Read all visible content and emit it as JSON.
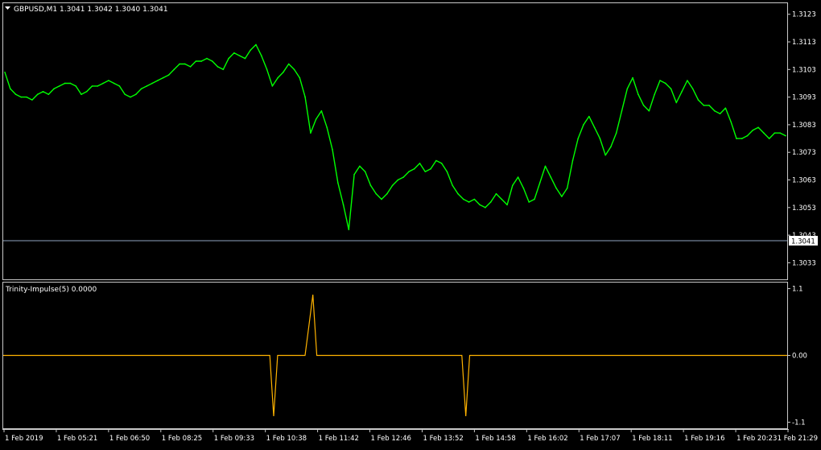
{
  "chart_data": [
    {
      "type": "line",
      "panel": "main",
      "symbol_timeframe": "GBPUSD,M1",
      "ohlc": {
        "open": "1.3041",
        "high": "1.3042",
        "low": "1.3040",
        "close": "1.3041"
      },
      "header_text": "GBPUSD,M1  1.3041 1.3042 1.3040 1.3041",
      "ylim": [
        1.3027,
        1.3127
      ],
      "y_ticks": [
        "1.3123",
        "1.3113",
        "1.3103",
        "1.3093",
        "1.3083",
        "1.3073",
        "1.3063",
        "1.3053",
        "1.3043",
        "1.3033"
      ],
      "current_price": "1.3041",
      "x_ticks": [
        "1 Feb 2019",
        "1 Feb 05:21",
        "1 Feb 06:50",
        "1 Feb 08:25",
        "1 Feb 09:33",
        "1 Feb 10:38",
        "1 Feb 11:42",
        "1 Feb 12:46",
        "1 Feb 13:52",
        "1 Feb 14:58",
        "1 Feb 16:02",
        "1 Feb 17:07",
        "1 Feb 18:11",
        "1 Feb 19:16",
        "1 Feb 20:23",
        "1 Feb 21:29"
      ],
      "series": [
        {
          "color": "#00ff00",
          "values": [
            1.3102,
            1.3096,
            1.3094,
            1.3093,
            1.3093,
            1.3092,
            1.3094,
            1.3095,
            1.3094,
            1.3096,
            1.3097,
            1.3098,
            1.3098,
            1.3097,
            1.3094,
            1.3095,
            1.3097,
            1.3097,
            1.3098,
            1.3099,
            1.3098,
            1.3097,
            1.3094,
            1.3093,
            1.3094,
            1.3096,
            1.3097,
            1.3098,
            1.3099,
            1.31,
            1.3101,
            1.3103,
            1.3105,
            1.3105,
            1.3104,
            1.3106,
            1.3106,
            1.3107,
            1.3106,
            1.3104,
            1.3103,
            1.3107,
            1.3109,
            1.3108,
            1.3107,
            1.311,
            1.3112,
            1.3108,
            1.3103,
            1.3097,
            1.31,
            1.3102,
            1.3105,
            1.3103,
            1.31,
            1.3093,
            1.308,
            1.3085,
            1.3088,
            1.3082,
            1.3074,
            1.3062,
            1.3054,
            1.3045,
            1.3065,
            1.3068,
            1.3066,
            1.3061,
            1.3058,
            1.3056,
            1.3058,
            1.3061,
            1.3063,
            1.3064,
            1.3066,
            1.3067,
            1.3069,
            1.3066,
            1.3067,
            1.307,
            1.3069,
            1.3066,
            1.3061,
            1.3058,
            1.3056,
            1.3055,
            1.3056,
            1.3054,
            1.3053,
            1.3055,
            1.3058,
            1.3056,
            1.3054,
            1.3061,
            1.3064,
            1.306,
            1.3055,
            1.3056,
            1.3062,
            1.3068,
            1.3064,
            1.306,
            1.3057,
            1.306,
            1.307,
            1.3078,
            1.3083,
            1.3086,
            1.3082,
            1.3078,
            1.3072,
            1.3075,
            1.308,
            1.3088,
            1.3096,
            1.31,
            1.3094,
            1.309,
            1.3088,
            1.3094,
            1.3099,
            1.3098,
            1.3096,
            1.3091,
            1.3095,
            1.3099,
            1.3096,
            1.3092,
            1.309,
            1.309,
            1.3088,
            1.3087,
            1.3089,
            1.3084,
            1.3078,
            1.3078,
            1.3079,
            1.3081,
            1.3082,
            1.308,
            1.3078,
            1.308,
            1.308,
            1.3079
          ]
        }
      ]
    },
    {
      "type": "line",
      "panel": "indicator",
      "indicator_label": "Trinity-Impulse(5) 0.0000",
      "ylim": [
        -1.2,
        1.2
      ],
      "y_ticks": [
        "1.1",
        "0.00",
        "-1.1"
      ],
      "x": [
        0,
        0.34,
        0.345,
        0.35,
        0.385,
        0.39,
        0.395,
        0.4,
        0.585,
        0.59,
        0.595,
        1
      ],
      "series": [
        {
          "color": "#ffb300",
          "values": [
            0,
            0,
            -1.0,
            0,
            0,
            0.5,
            1.0,
            0,
            0,
            -1.0,
            0,
            0
          ]
        }
      ]
    }
  ]
}
